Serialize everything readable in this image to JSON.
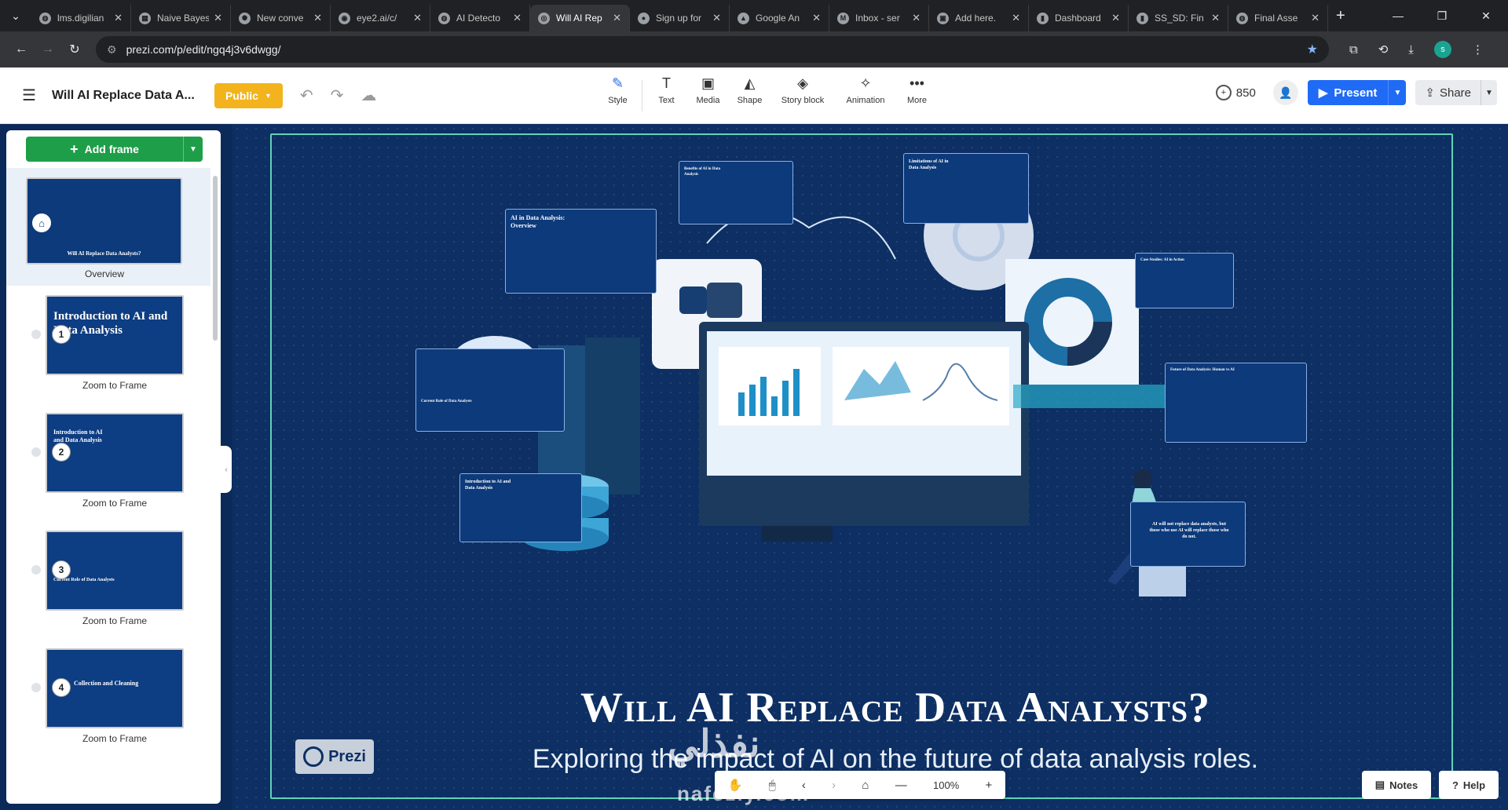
{
  "browser": {
    "tabs": [
      {
        "title": "lms.digilian",
        "icon": "globe-icon",
        "active": false
      },
      {
        "title": "Naive Bayes",
        "icon": "notebook-icon",
        "active": false
      },
      {
        "title": "New conve",
        "icon": "openai-icon",
        "active": false
      },
      {
        "title": "eye2.ai/c/",
        "icon": "eye2-icon",
        "active": false
      },
      {
        "title": "AI Detecto",
        "icon": "globe-icon",
        "active": false
      },
      {
        "title": "Will AI Rep",
        "icon": "prezi-icon",
        "active": true
      },
      {
        "title": "Sign up for",
        "icon": "github-icon",
        "active": false
      },
      {
        "title": "Google An",
        "icon": "analytics-icon",
        "active": false
      },
      {
        "title": "Inbox - ser",
        "icon": "gmail-icon",
        "active": false
      },
      {
        "title": "Add here.",
        "icon": "image-icon",
        "active": false
      },
      {
        "title": "Dashboard",
        "icon": "powerbi-icon",
        "active": false
      },
      {
        "title": "SS_SD: Fin",
        "icon": "powerbi-icon",
        "active": false
      },
      {
        "title": "Final Asse",
        "icon": "globe-icon",
        "active": false
      }
    ],
    "url": "prezi.com/p/edit/ngq4j3v6dwgg/",
    "profile_initial": "s"
  },
  "header": {
    "title": "Will AI Replace Data A...",
    "public_label": "Public",
    "tools": [
      {
        "label": "Style",
        "icon": "pen-icon"
      },
      {
        "label": "Text",
        "icon": "text-icon"
      },
      {
        "label": "Media",
        "icon": "image-icon"
      },
      {
        "label": "Shape",
        "icon": "shape-icon"
      },
      {
        "label": "Story block",
        "icon": "layers-icon"
      },
      {
        "label": "Animation",
        "icon": "animation-icon"
      },
      {
        "label": "More",
        "icon": "more-icon"
      }
    ],
    "credits": "850",
    "present_label": "Present",
    "share_label": "Share"
  },
  "sidebar": {
    "add_frame_label": "Add frame",
    "overview_label": "Overview",
    "overview_thumb_text": "Will AI Replace Data Analysts?",
    "frames": [
      {
        "num": "1",
        "thumb_title": "Introduction to AI and Data Analysis",
        "label": "Zoom to Frame"
      },
      {
        "num": "2",
        "thumb_title": "Introduction to AI and Data Analysis",
        "label": "Zoom to Frame"
      },
      {
        "num": "3",
        "thumb_title": "Current Role of Data Analysts",
        "label": "Zoom to Frame"
      },
      {
        "num": "4",
        "thumb_title": "Collection and Cleaning",
        "label": "Zoom to Frame"
      }
    ]
  },
  "canvas": {
    "title": "Will AI Replace Data Analysts?",
    "subtitle": "Exploring the impact of AI on the future of data analysis roles.",
    "logo_text": "Prezi",
    "mini_frames": [
      "AI in Data Analysis: Overview",
      "Benefits of AI in Data Analysis",
      "Limitations of AI in Data Analysis",
      "Case Studies: AI in Action",
      "Current Role of Data Analysts",
      "Introduction to AI and Data Analysis",
      "Future of Data Analysis: Human vs AI",
      "AI will not replace data analysts, but those who use AI will replace those who do not."
    ],
    "watermark": "نفذلي",
    "watermark_latin": "nafezly.com"
  },
  "bottom_bar": {
    "zoom": "100%",
    "notes_label": "Notes",
    "help_label": "Help"
  },
  "colors": {
    "accent_blue": "#1f6bf5",
    "public_yellow": "#f2b31d",
    "add_frame_green": "#1f9e49",
    "canvas_navy": "#0d2f63",
    "frame_border": "#5fd3b5"
  }
}
